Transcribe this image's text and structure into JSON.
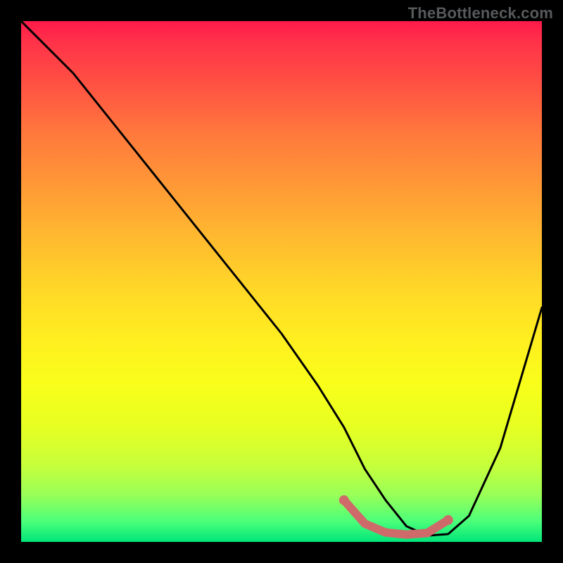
{
  "watermark": "TheBottleneck.com",
  "chart_data": {
    "type": "line",
    "title": "",
    "xlabel": "",
    "ylabel": "",
    "xlim": [
      0,
      100
    ],
    "ylim": [
      0,
      100
    ],
    "grid": false,
    "series": [
      {
        "name": "curve",
        "color": "#000000",
        "x": [
          0,
          4,
          10,
          20,
          30,
          40,
          50,
          57,
          62,
          66,
          70,
          74,
          78,
          82,
          86,
          92,
          100
        ],
        "y": [
          100,
          96,
          90,
          77.5,
          65,
          52.5,
          40,
          30,
          22,
          14,
          8,
          3,
          1.2,
          1.5,
          5,
          18,
          45
        ]
      },
      {
        "name": "highlight",
        "color": "#cf6a6a",
        "x": [
          62,
          66,
          70,
          74,
          78,
          82
        ],
        "y": [
          8,
          3.5,
          1.8,
          1.4,
          1.7,
          4.2
        ]
      }
    ],
    "gradient_stops": [
      {
        "pos": 0.0,
        "color": "#ff1a4a"
      },
      {
        "pos": 0.04,
        "color": "#ff3249"
      },
      {
        "pos": 0.12,
        "color": "#ff5143"
      },
      {
        "pos": 0.22,
        "color": "#ff7a3c"
      },
      {
        "pos": 0.32,
        "color": "#ff9a36"
      },
      {
        "pos": 0.42,
        "color": "#ffbb2f"
      },
      {
        "pos": 0.52,
        "color": "#ffd927"
      },
      {
        "pos": 0.62,
        "color": "#fff01f"
      },
      {
        "pos": 0.7,
        "color": "#f8ff1a"
      },
      {
        "pos": 0.78,
        "color": "#e6ff22"
      },
      {
        "pos": 0.85,
        "color": "#c8ff3a"
      },
      {
        "pos": 0.91,
        "color": "#99ff58"
      },
      {
        "pos": 0.96,
        "color": "#4cff7a"
      },
      {
        "pos": 1.0,
        "color": "#00e67a"
      }
    ]
  }
}
